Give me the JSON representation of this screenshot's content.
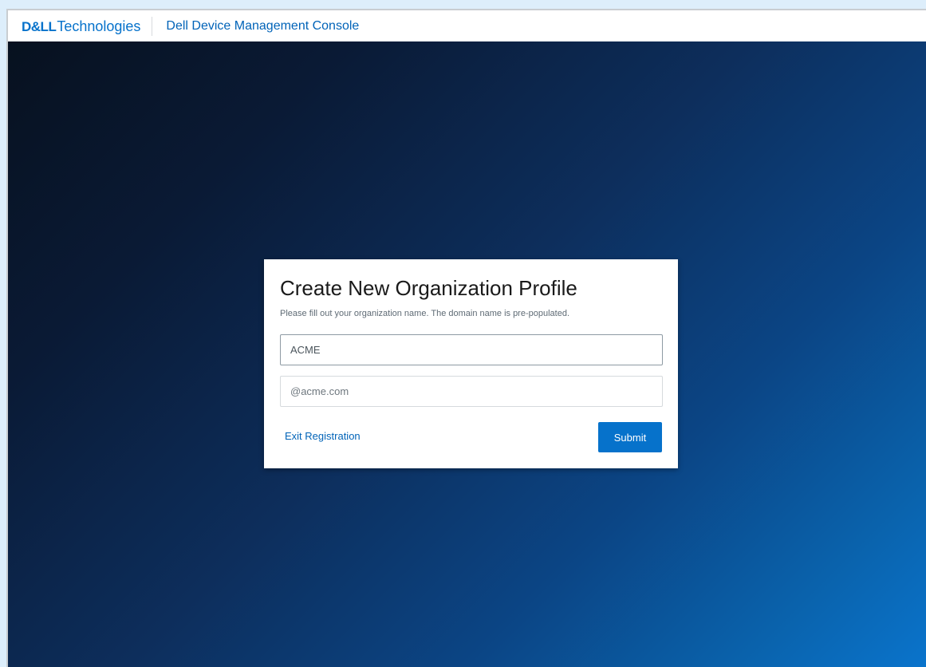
{
  "header": {
    "brand_primary": "D&LL",
    "brand_secondary": "Technologies",
    "app_title": "Dell Device Management Console"
  },
  "card": {
    "title": "Create New Organization Profile",
    "subtitle": "Please fill out your organization name. The domain name is pre-populated.",
    "org_name_value": "ACME",
    "domain_value": "@acme.com",
    "exit_label": "Exit Registration",
    "submit_label": "Submit"
  },
  "colors": {
    "brand_blue": "#0672cb",
    "link_blue": "#0063b8",
    "background_dark": "#07111f",
    "background_light": "#0a74cc"
  }
}
